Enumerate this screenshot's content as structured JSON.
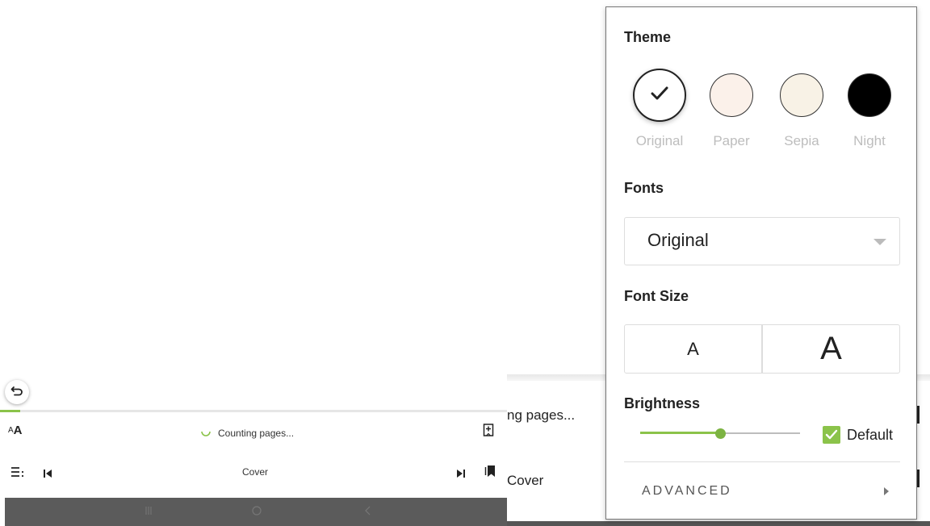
{
  "reader": {
    "counting_text": "Counting pages...",
    "cover_label": "Cover",
    "aa_small": "A",
    "aa_large": "A",
    "progress_fraction": 0.04
  },
  "peek": {
    "counting_text": "ng pages...",
    "cover_text": "Cover"
  },
  "settings": {
    "theme_title": "Theme",
    "themes": [
      {
        "label": "Original",
        "color": "#ffffff",
        "selected": true
      },
      {
        "label": "Paper",
        "color": "#fbf1ea",
        "selected": false
      },
      {
        "label": "Sepia",
        "color": "#f8f2e6",
        "selected": false
      },
      {
        "label": "Night",
        "color": "#000000",
        "selected": false
      }
    ],
    "fonts_title": "Fonts",
    "font_selected": "Original",
    "font_size_title": "Font Size",
    "size_decrease_label": "A",
    "size_increase_label": "A",
    "brightness_title": "Brightness",
    "brightness_value": 0.5,
    "default_label": "Default",
    "default_checked": true,
    "advanced_label": "ADVANCED"
  },
  "colors": {
    "accent": "#8bc34a",
    "system_bar": "#5b5b5b"
  }
}
